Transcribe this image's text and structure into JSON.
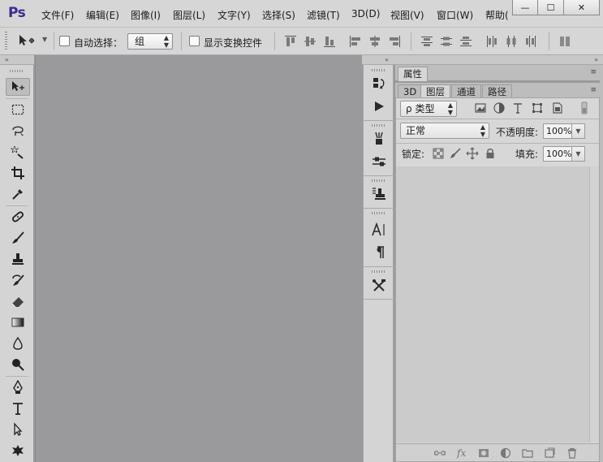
{
  "app": {
    "logo": "Ps"
  },
  "menu": {
    "items": [
      "文件(F)",
      "编辑(E)",
      "图像(I)",
      "图层(L)",
      "文字(Y)",
      "选择(S)",
      "滤镜(T)",
      "3D(D)",
      "视图(V)",
      "窗口(W)",
      "帮助("
    ]
  },
  "window_controls": {
    "minimize": "—",
    "maximize": "☐",
    "close": "✕"
  },
  "options_bar": {
    "tool_icon": "move-tool-icon",
    "auto_select_label": "自动选择：",
    "auto_select_checked": false,
    "auto_select_target": "组",
    "show_transform_label": "显示变换控件",
    "show_transform_checked": false
  },
  "toolbar": {
    "collapse_arrow": "»",
    "tools": [
      "move-tool",
      "marquee-tool",
      "lasso-tool",
      "quick-select-tool",
      "crop-tool",
      "eyedropper-tool",
      "healing-brush-tool",
      "brush-tool",
      "clone-stamp-tool",
      "history-brush-tool",
      "eraser-tool",
      "gradient-tool",
      "blur-tool",
      "dodge-tool",
      "pen-tool",
      "type-tool",
      "path-select-tool",
      "custom-shape-tool"
    ],
    "active_tool": "move-tool"
  },
  "dock": {
    "collapse_arrow": "«",
    "expand_arrow": "»",
    "buttons": [
      "history",
      "actions",
      "brush-presets",
      "brush",
      "clone-source",
      "character",
      "paragraph",
      "tool-presets"
    ]
  },
  "properties_panel": {
    "tab_label": "属性",
    "menu_icon": "≡"
  },
  "layers_panel": {
    "tabs": [
      "3D",
      "图层",
      "通道",
      "路径"
    ],
    "active_tab": "图层",
    "filter_kind": "类型",
    "filter_prefix": "ρ",
    "blend_mode": "正常",
    "opacity_label": "不透明度:",
    "opacity_value": "100%",
    "lock_label": "锁定:",
    "fill_label": "填充:",
    "fill_value": "100%",
    "footer_icons": [
      "link-layers",
      "fx",
      "add-mask",
      "adjustment-layer",
      "new-group",
      "new-layer",
      "delete-layer"
    ],
    "footer_fx": "fx"
  }
}
